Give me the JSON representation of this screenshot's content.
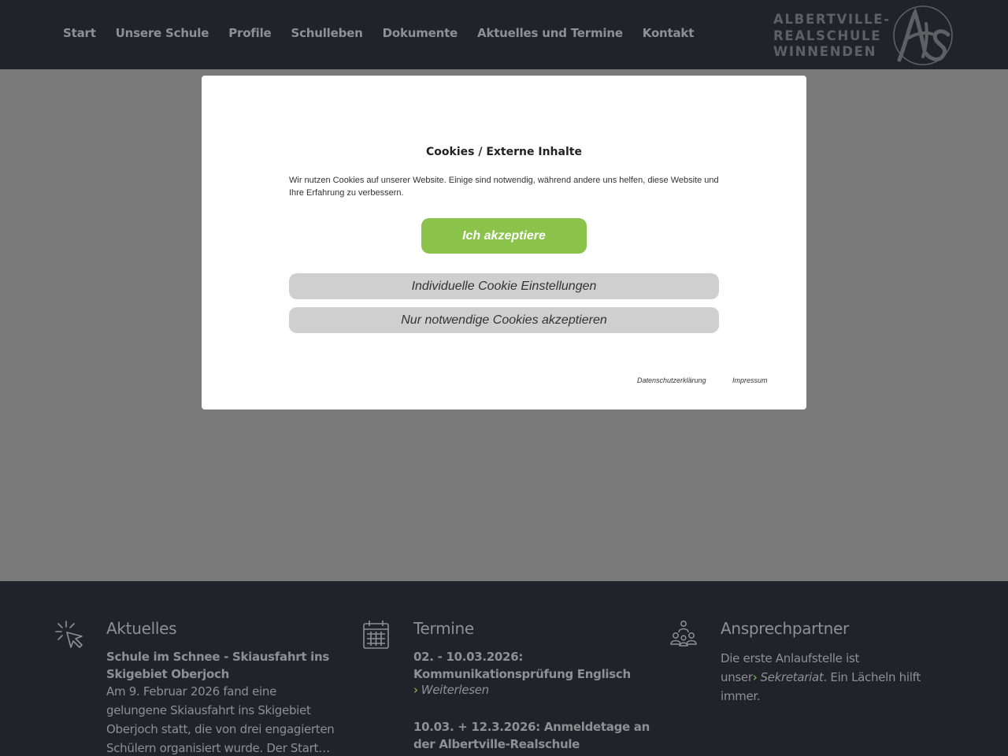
{
  "nav": {
    "items": [
      "Start",
      "Unsere Schule",
      "Profile",
      "Schulleben",
      "Dokumente",
      "Aktuelles und Termine",
      "Kontakt"
    ]
  },
  "logo": {
    "line1": "ALBERTVILLE-",
    "line2": "REALSCHULE",
    "line3": "WINNENDEN",
    "mark_text": "ARS"
  },
  "cookie_modal": {
    "title": "Cookies / Externe Inhalte",
    "text": "Wir nutzen Cookies auf unserer Website. Einige sind notwendig, während andere uns helfen, diese Website und Ihre Erfahrung zu verbessern.",
    "accept_label": "Ich akzeptiere",
    "individual_label": "Individuelle Cookie Einstellungen",
    "necessary_label": "Nur notwendige Cookies akzeptieren",
    "privacy_link": "Datenschutzerklärung",
    "imprint_link": "Impressum"
  },
  "footer": {
    "news": {
      "title": "Aktuelles",
      "headline": "Schule im Schnee - Skiausfahrt ins Skigebiet Oberjoch",
      "body": "Am 9. Februar 2026 fand eine gelungene Skiausfahrt ins Skigebiet Oberjoch statt, die von drei engagierten Schülern organisiert wurde. Der Start…"
    },
    "events": {
      "title": "Termine",
      "event1": "02. - 10.03.2026: Kommunikationsprüfung Englisch",
      "readmore": "Weiterlesen",
      "event2": "10.03. + 12.3.2026: Anmeldetage an der Albertville-Realschule"
    },
    "contact": {
      "title": "Ansprechpartner",
      "text_before": "Die erste Anlaufstelle ist unser",
      "link": "Sekretariat",
      "text_after": ". Ein Lächeln hilft immer."
    }
  },
  "colors": {
    "header_bg": "#20232a",
    "overlay": "#7a7a7a",
    "accent_green": "#8bc34a",
    "muted_text": "#8e9093"
  }
}
